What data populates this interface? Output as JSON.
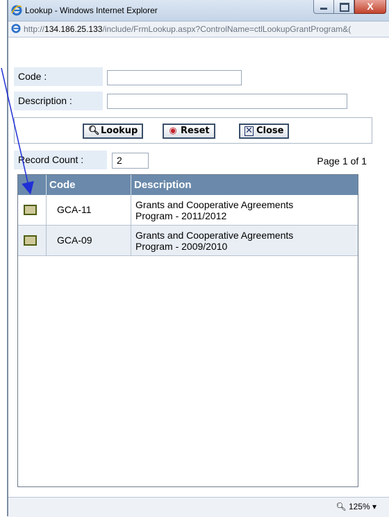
{
  "window": {
    "title": "Lookup - Windows Internet Explorer",
    "close_glyph": "X",
    "address_prefix": "http://",
    "address_host": "134.186.25.133",
    "address_path": "/include/FrmLookup.aspx?ControlName=ctlLookupGrantProgram&("
  },
  "search": {
    "code_label": "Code :",
    "code_value": "",
    "description_label": "Description :",
    "description_value": ""
  },
  "buttons": {
    "lookup": "Lookup",
    "reset": "Reset",
    "close": "Close"
  },
  "records": {
    "count_label": "Record Count :",
    "count_value": "2",
    "page_info": "Page 1 of 1"
  },
  "grid": {
    "columns": [
      "",
      "Code",
      "Description"
    ],
    "rows": [
      {
        "code": "GCA-11",
        "description_line1": "Grants and Cooperative Agreements",
        "description_line2": "Program - 2011/2012"
      },
      {
        "code": "GCA-09",
        "description_line1": "Grants and Cooperative Agreements",
        "description_line2": "Program - 2009/2010"
      }
    ]
  },
  "status": {
    "zoom": "125%"
  },
  "colors": {
    "header_bg": "#6b8aab",
    "label_bg": "#e4edf6",
    "arrow": "#1f2fd6"
  }
}
